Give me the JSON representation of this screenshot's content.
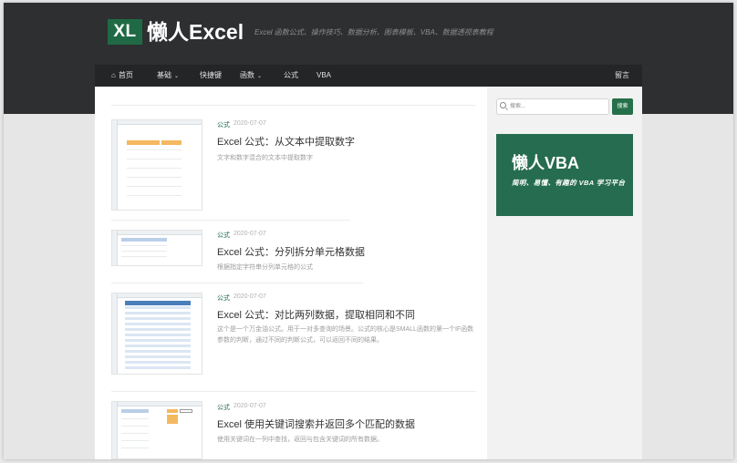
{
  "site": {
    "logo_mark": "XL",
    "logo_text": "懒人Excel",
    "tagline": "Excel 函数公式、操作技巧、数据分析、图表模板、VBA、数据透视表教程"
  },
  "nav": {
    "home": "首页",
    "basic": "基础",
    "shortcuts": "快捷键",
    "functions": "函数",
    "formulas": "公式",
    "vba": "VBA",
    "guestbook": "留言",
    "home_icon": "home-icon",
    "caret_icon": "chevron-down-icon"
  },
  "search": {
    "placeholder": "搜索...",
    "button": "搜索"
  },
  "banner": {
    "title": "懒人VBA",
    "subtitle": "简明、易懂、有趣的 VBA 学习平台"
  },
  "posts": [
    {
      "category": "公式",
      "date": "2020-07-07",
      "title": "Excel 公式：从文本中提取数字",
      "excerpt": "文字和数字混合的文本中提取数字"
    },
    {
      "category": "公式",
      "date": "2020-07-07",
      "title": "Excel 公式：分列拆分单元格数据",
      "excerpt": "根据指定字符串分列单元格的公式"
    },
    {
      "category": "公式",
      "date": "2020-07-07",
      "title": "Excel 公式：对比两列数据，提取相同和不同",
      "excerpt": "这个是一个万金油公式。用于一对多查询的场景。公式的核心是SMALL函数的第一个IF函数参数的判断，通过不同的判断公式，可以返回不同的结果。"
    },
    {
      "category": "公式",
      "date": "2020-07-07",
      "title": "Excel 使用关键词搜索并返回多个匹配的数据",
      "excerpt": "使用关键词在一列中查找，返回与包含关键词的所有数据。"
    }
  ],
  "colors": {
    "header_bg": "#2d2f31",
    "nav_bg": "#232527",
    "brand_green": "#1f6a45",
    "banner_green": "#266c50"
  }
}
